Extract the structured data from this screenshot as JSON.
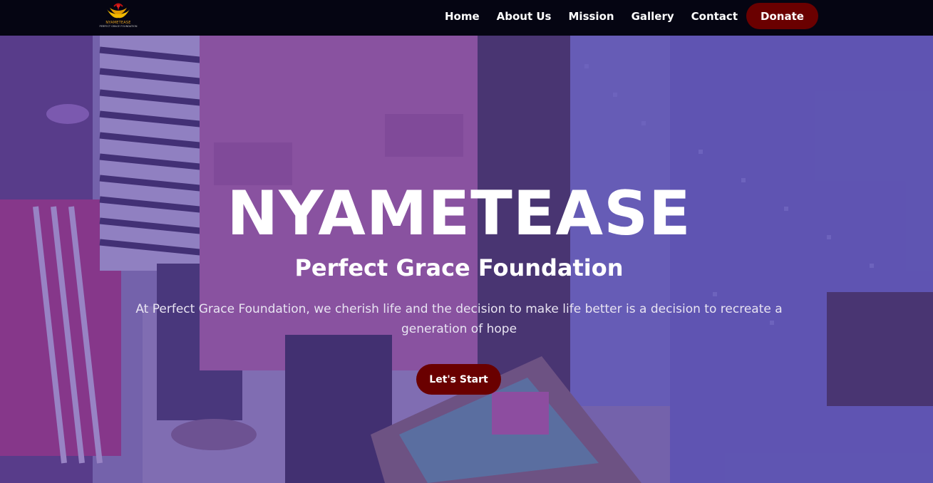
{
  "brand": {
    "logo_name": "NYAMETEASE",
    "logo_tagline": "PERFECT GRACE FOUNDATION"
  },
  "nav": {
    "items": [
      {
        "label": "Home"
      },
      {
        "label": "About Us"
      },
      {
        "label": "Mission"
      },
      {
        "label": "Gallery"
      },
      {
        "label": "Contact"
      }
    ],
    "donate_label": "Donate"
  },
  "hero": {
    "title": "NYAMETEASE",
    "subtitle": "Perfect Grace Foundation",
    "description": "At Perfect Grace Foundation, we cherish life and the decision to make life better is a decision to recreate a generation of hope",
    "cta_label": "Let's Start"
  },
  "colors": {
    "navbar_bg": "#050512",
    "button_bg": "#6a0000",
    "overlay": "#563ea0",
    "text": "#ffffff"
  }
}
